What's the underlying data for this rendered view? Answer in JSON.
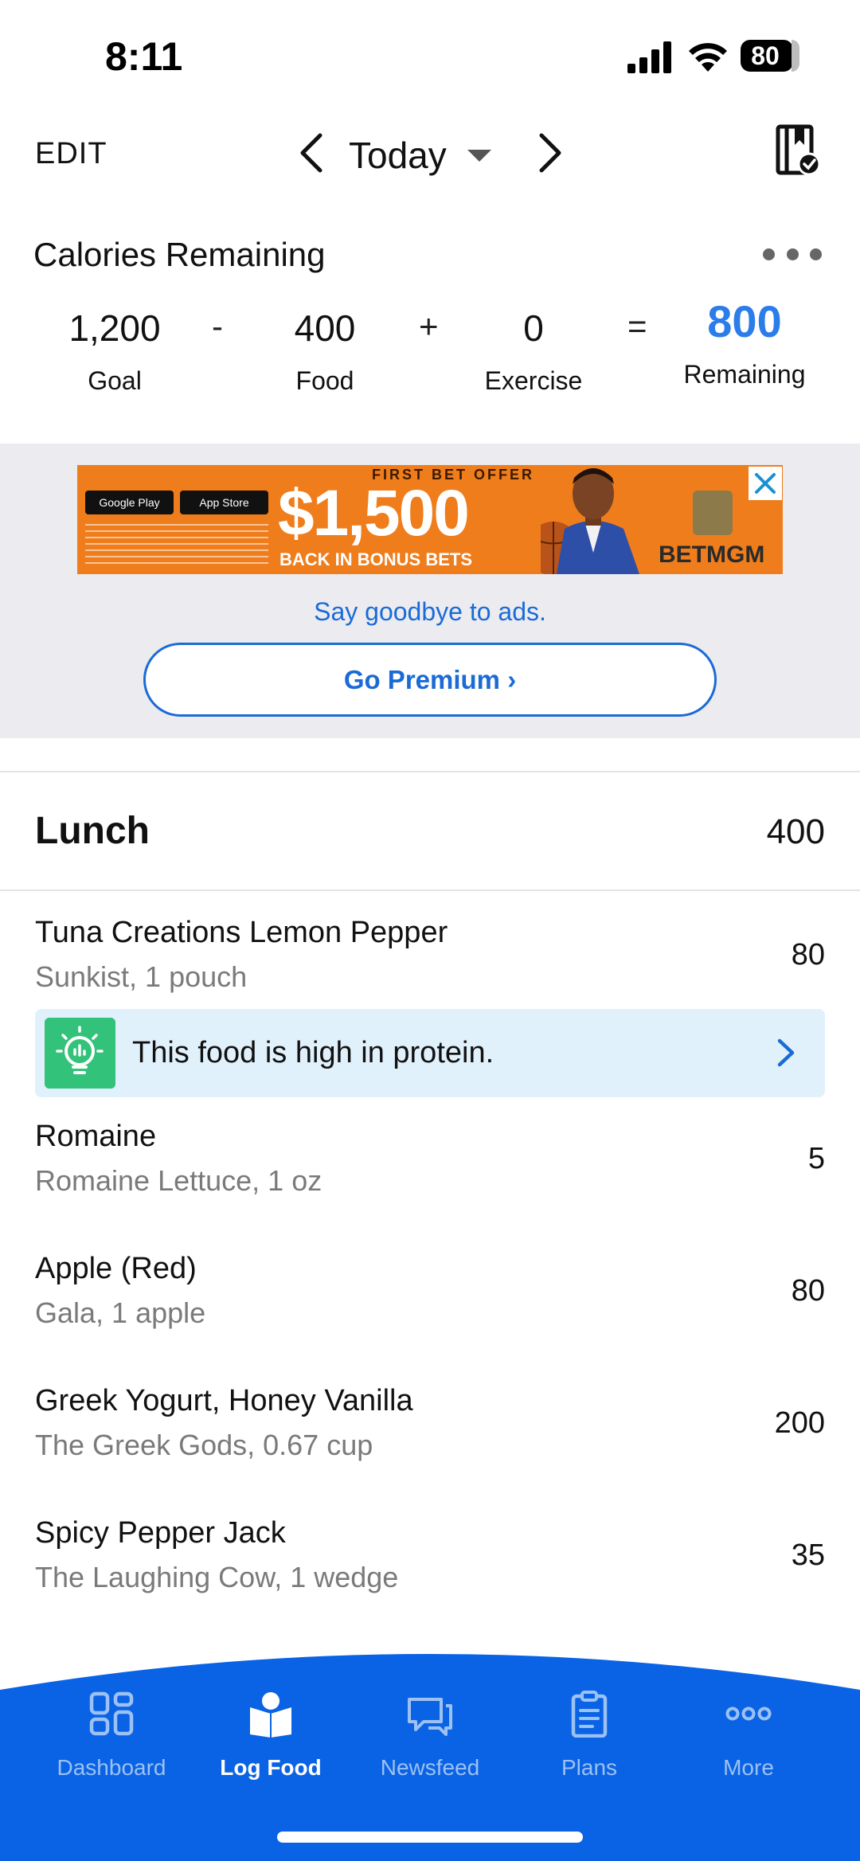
{
  "status_bar": {
    "time": "8:11",
    "battery": "80"
  },
  "header": {
    "edit_label": "EDIT",
    "date_label": "Today"
  },
  "calories": {
    "title": "Calories Remaining",
    "goal": {
      "value": "1,200",
      "label": "Goal"
    },
    "food": {
      "value": "400",
      "label": "Food"
    },
    "exercise": {
      "value": "0",
      "label": "Exercise"
    },
    "remaining": {
      "value": "800",
      "label": "Remaining"
    },
    "op_minus": "-",
    "op_plus": "+",
    "op_equals": "="
  },
  "ad": {
    "offer_line": "FIRST BET OFFER",
    "amount": "$1,500",
    "bonus_line": "BACK IN BONUS BETS",
    "store_google": "Google Play",
    "store_apple": "App Store",
    "brand": "BETMGM",
    "goodbye_text": "Say goodbye to ads.",
    "premium_label": "Go Premium ›"
  },
  "meal": {
    "title": "Lunch",
    "total": "400",
    "items": [
      {
        "name": "Tuna Creations Lemon Pepper",
        "desc": "Sunkist, 1 pouch",
        "cal": "80"
      },
      {
        "name": "Romaine",
        "desc": "Romaine Lettuce, 1 oz",
        "cal": "5"
      },
      {
        "name": "Apple (Red)",
        "desc": "Gala, 1 apple",
        "cal": "80"
      },
      {
        "name": "Greek Yogurt, Honey Vanilla",
        "desc": "The Greek Gods, 0.67 cup",
        "cal": "200"
      },
      {
        "name": "Spicy Pepper Jack",
        "desc": "The Laughing Cow, 1 wedge",
        "cal": "35"
      }
    ],
    "insight": "This food is high in protein."
  },
  "nav": {
    "items": [
      {
        "label": "Dashboard",
        "icon": "dashboard-icon"
      },
      {
        "label": "Log Food",
        "icon": "log-food-icon"
      },
      {
        "label": "Newsfeed",
        "icon": "newsfeed-icon"
      },
      {
        "label": "Plans",
        "icon": "plans-icon"
      },
      {
        "label": "More",
        "icon": "more-icon"
      }
    ],
    "active": "Log Food"
  },
  "colors": {
    "accent": "#2b7de9",
    "link": "#1a6bd6",
    "nav_bg": "#0a63e4",
    "ad_bg": "#ebebf0",
    "insight_bg": "#e1f1fb",
    "insight_icon": "#32c27a"
  }
}
